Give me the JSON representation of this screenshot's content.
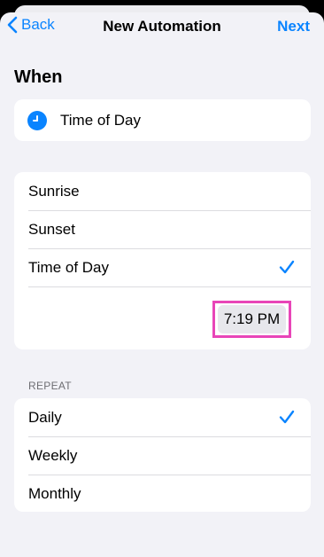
{
  "nav": {
    "back_label": "Back",
    "title": "New Automation",
    "next_label": "Next"
  },
  "when": {
    "heading": "When",
    "trigger": {
      "icon": "clock-icon",
      "label": "Time of Day"
    }
  },
  "options": [
    {
      "label": "Sunrise",
      "selected": false
    },
    {
      "label": "Sunset",
      "selected": false
    },
    {
      "label": "Time of Day",
      "selected": true
    }
  ],
  "time": {
    "value": "7:19 PM"
  },
  "repeat": {
    "header": "REPEAT",
    "items": [
      {
        "label": "Daily",
        "selected": true
      },
      {
        "label": "Weekly",
        "selected": false
      },
      {
        "label": "Monthly",
        "selected": false
      }
    ]
  },
  "colors": {
    "accent": "#0a84ff",
    "highlight": "#e845b8",
    "background": "#f2f2f7"
  }
}
